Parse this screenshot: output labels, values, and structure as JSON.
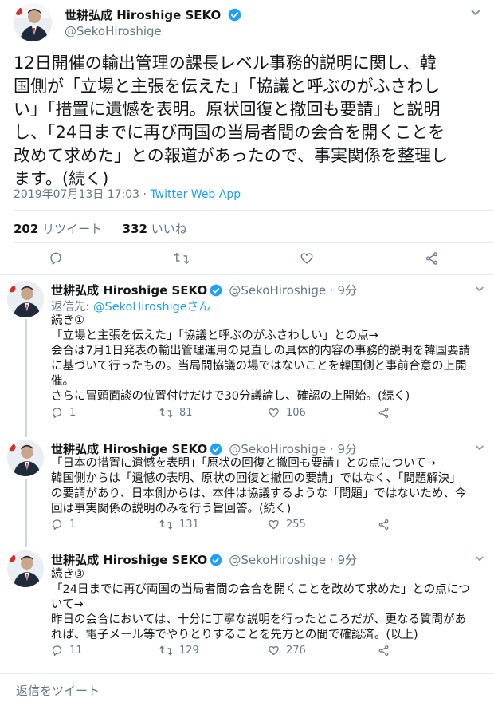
{
  "main_tweet": {
    "display_name": "世耕弘成 Hiroshige SEKO",
    "handle": "@SekoHiroshige",
    "text_lines": [
      "12日開催の輸出管理の課長レベル事務的説明に関し、韓",
      "国側が「立場と主張を伝えた」「協議と呼ぶのがふさわし",
      "い」「措置に遺憾を表明。原状回復と撤回も要請」と説明",
      "し、「24日までに再び両国の当局者間の会合を開くことを",
      "改めて求めた」との報道があったので、事実関係を整理し",
      "ます。(続く)"
    ],
    "timestamp": "2019年07月13日 17:03",
    "separator": " · ",
    "source": "Twitter Web App",
    "retweet_count": "202",
    "retweet_label": " リツイート",
    "like_count": "332",
    "like_label": " いいね"
  },
  "replies": [
    {
      "display_name": "世耕弘成 Hiroshige SEKO",
      "handle": "@SekoHiroshige",
      "time": " · 9分",
      "reply_to_label": "返信先: ",
      "reply_to_mention": "@SekoHiroshigeさん",
      "text_lines": [
        "続き①",
        "「立場と主張を伝えた」「協議と呼ぶのがふさわしい」との点→",
        "会合は7月1日発表の輸出管理運用の見直しの具体的内容の事務的説明を韓国要請",
        "に基づいて行ったもの。当局間協議の場ではないことを韓国側と事前合意の上開",
        "催。",
        "さらに冒頭面談の位置付けだけで30分議論し、確認の上開始。(続く)"
      ],
      "replies": "1",
      "retweets": "81",
      "likes": "106"
    },
    {
      "display_name": "世耕弘成 Hiroshige SEKO",
      "handle": "@SekoHiroshige",
      "time": " · 9分",
      "text_lines": [
        "「日本の措置に遺憾を表明」「原状の回復と撤回も要請」との点について→",
        "韓国側からは「遺憾の表明、原状の回復と撤回の要請」ではなく、「問題解決」",
        "の要請があり、日本側からは、本件は協議するような「問題」ではないため、今",
        "回は事実関係の説明のみを行う旨回答。(続く)"
      ],
      "replies": "1",
      "retweets": "131",
      "likes": "255"
    },
    {
      "display_name": "世耕弘成 Hiroshige SEKO",
      "handle": "@SekoHiroshige",
      "time": " · 9分",
      "text_lines": [
        "続き③",
        "「24日までに再び両国の当局者間の会合を開くことを改めて求めた」との点につ",
        "いて→",
        "昨日の会合においては、十分に丁寧な説明を行ったところだが、更なる質問があ",
        "れば、電子メール等でやりとりすることを先方との間で確認済。(以上)"
      ],
      "replies": "11",
      "retweets": "129",
      "likes": "276"
    }
  ],
  "reply_bar": {
    "placeholder": "返信をツイート"
  },
  "icons": {
    "verified": "verified-badge-icon",
    "chevron": "chevron-down-icon",
    "reply": "reply-icon",
    "retweet": "retweet-icon",
    "like": "heart-icon",
    "share": "share-icon"
  },
  "colors": {
    "accent": "#1da1f2",
    "muted": "#657786",
    "text": "#14171a",
    "divider": "#e6ecf0"
  }
}
